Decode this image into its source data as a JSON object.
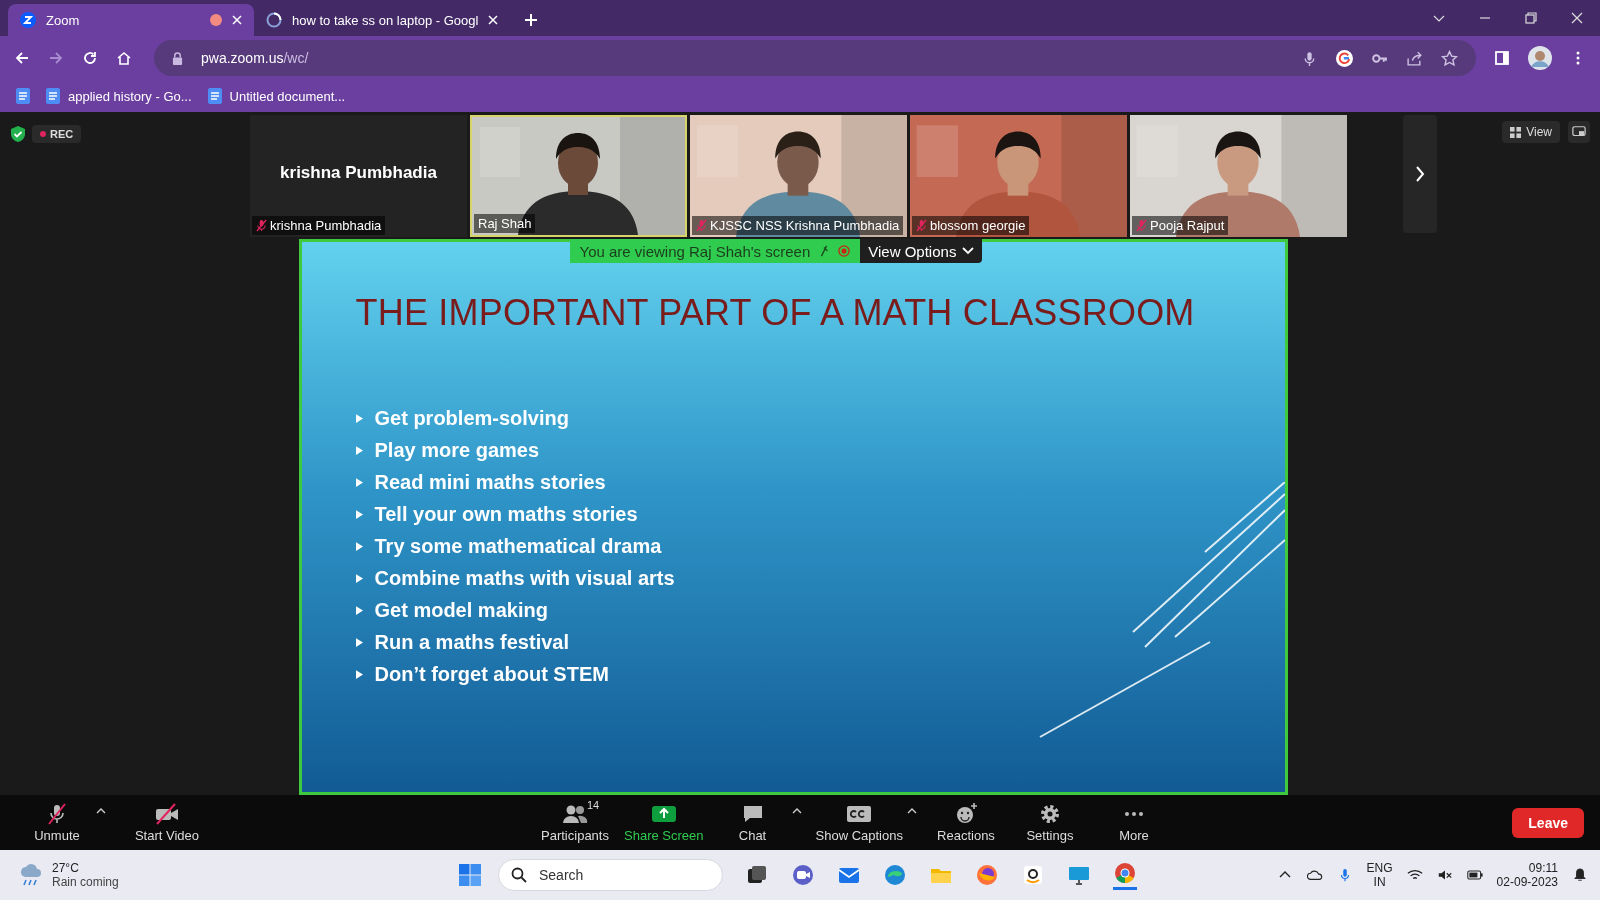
{
  "browser": {
    "tabs": [
      {
        "title": "Zoom",
        "kind": "zoom",
        "selected": true,
        "recording": true
      },
      {
        "title": "how to take ss on laptop - Googl",
        "kind": "loading",
        "selected": false,
        "recording": false
      }
    ],
    "url": {
      "host": "pwa.zoom.us",
      "path": "/wc/"
    },
    "bookmarks": [
      {
        "title": "applied history - Go..."
      },
      {
        "title": "Untitled document..."
      }
    ]
  },
  "meeting": {
    "recording_label": "REC",
    "view_label": "View",
    "participants": [
      {
        "name": "krishna Pumbhadia",
        "kind": "avatar",
        "display_name": "krishna Pumbhadia",
        "muted": true,
        "speaking": false
      },
      {
        "name": "Raj Shah",
        "kind": "video",
        "muted": false,
        "speaking": true
      },
      {
        "name": "KJSSC NSS Krishna Pumbhadia",
        "kind": "video",
        "muted": true,
        "speaking": false
      },
      {
        "name": "blossom georgie",
        "kind": "video",
        "muted": true,
        "speaking": false
      },
      {
        "name": "Pooja Rajput",
        "kind": "video",
        "muted": true,
        "speaking": false
      }
    ],
    "share_banner": {
      "text": "You are viewing Raj Shah's screen",
      "options_label": "View Options"
    },
    "slide": {
      "title": "THE IMPORTANT PART OF A MATH CLASSROOM",
      "bullets": [
        "Get problem-solving",
        "Play more games",
        "Read mini maths stories",
        "Tell your own maths stories",
        "Try some mathematical drama",
        "Combine maths with visual arts",
        "Get model making",
        "Run a maths festival",
        "Don’t forget about STEM"
      ]
    }
  },
  "toolbar": {
    "items": [
      {
        "label": "Unmute",
        "kind": "mic",
        "caret": true,
        "highlighted": false
      },
      {
        "label": "Start Video",
        "kind": "video",
        "caret": false,
        "highlighted": false
      },
      {
        "label": "Participants",
        "kind": "participants",
        "badge": "14",
        "caret": false,
        "highlighted": false
      },
      {
        "label": "Share Screen",
        "kind": "share",
        "caret": false,
        "highlighted": true
      },
      {
        "label": "Chat",
        "kind": "chat",
        "caret": true,
        "highlighted": false
      },
      {
        "label": "Show Captions",
        "kind": "captions",
        "caret": true,
        "highlighted": false
      },
      {
        "label": "Reactions",
        "kind": "reactions",
        "caret": false,
        "highlighted": false
      },
      {
        "label": "Settings",
        "kind": "settings",
        "caret": false,
        "highlighted": false
      },
      {
        "label": "More",
        "kind": "more",
        "caret": false,
        "highlighted": false
      }
    ],
    "leave_label": "Leave"
  },
  "taskbar": {
    "weather": {
      "temperature": "27°C",
      "text": "Rain coming"
    },
    "search_placeholder": "Search",
    "language": [
      "ENG",
      "IN"
    ],
    "time": "09:11",
    "date": "02-09-2023"
  }
}
